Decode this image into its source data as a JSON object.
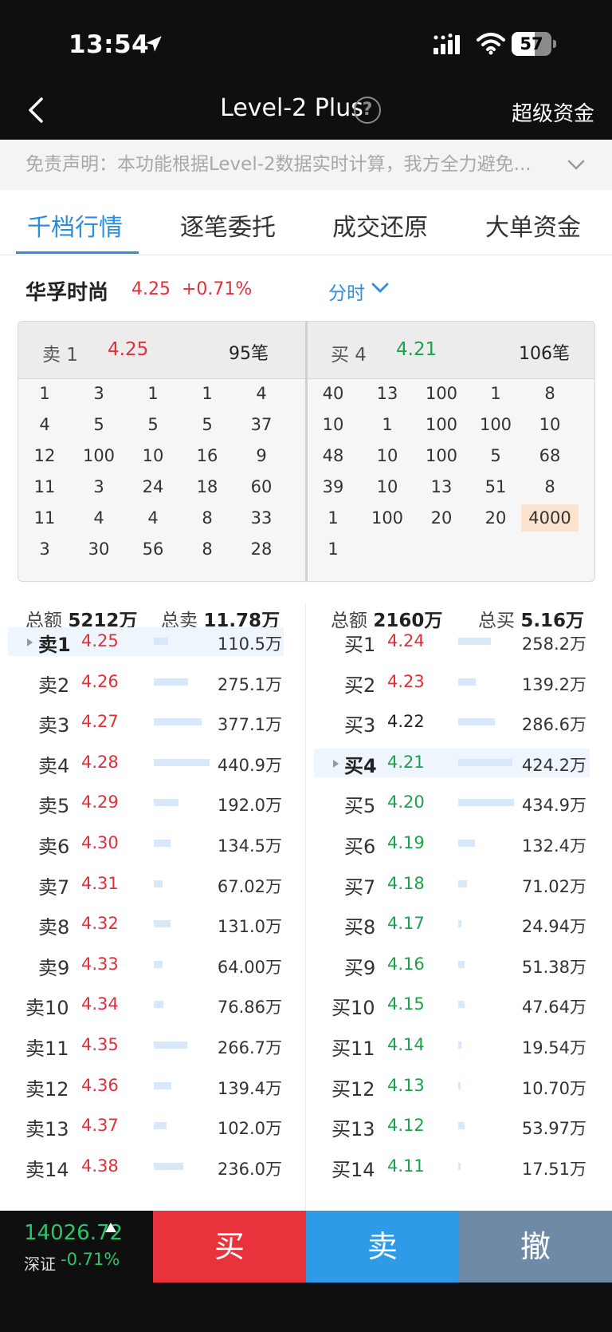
{
  "status": {
    "time": "13:54",
    "battery": "57",
    "battery_level": 0.57
  },
  "header": {
    "title": "Level-2 Plus",
    "right": "超级资金"
  },
  "notice": "免责声明：本功能根据Level-2数据实时计算，我方全力避免...",
  "tabs": [
    "千档行情",
    "逐笔委托",
    "成交还原",
    "大单资金"
  ],
  "stock": {
    "name": "华孚时尚",
    "price": "4.25",
    "change": "+0.71%",
    "period": "分时"
  },
  "queue": {
    "sell": {
      "label": "卖 1",
      "price": "4.25",
      "count": "95笔",
      "rows": [
        [
          "1",
          "3",
          "1",
          "1",
          "4"
        ],
        [
          "4",
          "5",
          "5",
          "5",
          "37"
        ],
        [
          "12",
          "100",
          "10",
          "16",
          "9"
        ],
        [
          "11",
          "3",
          "24",
          "18",
          "60"
        ],
        [
          "11",
          "4",
          "4",
          "8",
          "33"
        ],
        [
          "3",
          "30",
          "56",
          "8",
          "28"
        ]
      ]
    },
    "buy": {
      "label": "买 4",
      "price": "4.21",
      "count": "106笔",
      "rows": [
        [
          "40",
          "13",
          "100",
          "1",
          "8"
        ],
        [
          "10",
          "1",
          "100",
          "100",
          "10"
        ],
        [
          "48",
          "10",
          "100",
          "5",
          "68"
        ],
        [
          "39",
          "10",
          "13",
          "51",
          "8"
        ],
        [
          "1",
          "100",
          "20",
          "20",
          "4000"
        ],
        [
          "1"
        ]
      ]
    }
  },
  "depth": {
    "sell_total_label": "总额",
    "sell_total": "5212万",
    "sell_sum_label": "总卖",
    "sell_sum": "11.78万",
    "buy_total_label": "总额",
    "buy_total": "2160万",
    "buy_sum_label": "总买",
    "buy_sum": "5.16万",
    "sell": [
      {
        "level": "卖1",
        "price": "4.25",
        "volume": "110.5万",
        "bar": 0.25
      },
      {
        "level": "卖2",
        "price": "4.26",
        "volume": "275.1万",
        "bar": 0.62
      },
      {
        "level": "卖3",
        "price": "4.27",
        "volume": "377.1万",
        "bar": 0.86
      },
      {
        "level": "卖4",
        "price": "4.28",
        "volume": "440.9万",
        "bar": 1.0
      },
      {
        "level": "卖5",
        "price": "4.29",
        "volume": "192.0万",
        "bar": 0.44
      },
      {
        "level": "卖6",
        "price": "4.30",
        "volume": "134.5万",
        "bar": 0.3
      },
      {
        "level": "卖7",
        "price": "4.31",
        "volume": "67.02万",
        "bar": 0.15
      },
      {
        "level": "卖8",
        "price": "4.32",
        "volume": "131.0万",
        "bar": 0.3
      },
      {
        "level": "卖9",
        "price": "4.33",
        "volume": "64.00万",
        "bar": 0.15
      },
      {
        "level": "卖10",
        "price": "4.34",
        "volume": "76.86万",
        "bar": 0.17
      },
      {
        "level": "卖11",
        "price": "4.35",
        "volume": "266.7万",
        "bar": 0.6
      },
      {
        "level": "卖12",
        "price": "4.36",
        "volume": "139.4万",
        "bar": 0.32
      },
      {
        "level": "卖13",
        "price": "4.37",
        "volume": "102.0万",
        "bar": 0.23
      },
      {
        "level": "卖14",
        "price": "4.38",
        "volume": "236.0万",
        "bar": 0.53
      }
    ],
    "buy": [
      {
        "level": "买1",
        "price": "4.24",
        "volume": "258.2万",
        "bar": 0.59
      },
      {
        "level": "买2",
        "price": "4.23",
        "volume": "139.2万",
        "bar": 0.32
      },
      {
        "level": "买3",
        "price": "4.22",
        "volume": "286.6万",
        "bar": 0.66
      },
      {
        "level": "买4",
        "price": "4.21",
        "volume": "424.2万",
        "bar": 0.97
      },
      {
        "level": "买5",
        "price": "4.20",
        "volume": "434.9万",
        "bar": 1.0
      },
      {
        "level": "买6",
        "price": "4.19",
        "volume": "132.4万",
        "bar": 0.3
      },
      {
        "level": "买7",
        "price": "4.18",
        "volume": "71.02万",
        "bar": 0.16
      },
      {
        "level": "买8",
        "price": "4.17",
        "volume": "24.94万",
        "bar": 0.06
      },
      {
        "level": "买9",
        "price": "4.16",
        "volume": "51.38万",
        "bar": 0.12
      },
      {
        "level": "买10",
        "price": "4.15",
        "volume": "47.64万",
        "bar": 0.11
      },
      {
        "level": "买11",
        "price": "4.14",
        "volume": "19.54万",
        "bar": 0.05
      },
      {
        "level": "买12",
        "price": "4.13",
        "volume": "10.70万",
        "bar": 0.03
      },
      {
        "level": "买13",
        "price": "4.12",
        "volume": "53.97万",
        "bar": 0.12
      },
      {
        "level": "买14",
        "price": "4.11",
        "volume": "17.51万",
        "bar": 0.04
      }
    ]
  },
  "bottom": {
    "index_value": "14026.72",
    "index_name": "深证",
    "index_change": "-0.71%",
    "buy": "买",
    "sell": "卖",
    "cancel": "撤"
  },
  "colors": {
    "up": "#e0303a",
    "down": "#1aa34a",
    "accent": "#2a8fe0",
    "buy_btn": "#e8323c",
    "sell_btn": "#2f9be8",
    "cancel_btn": "#6f8aa6"
  }
}
